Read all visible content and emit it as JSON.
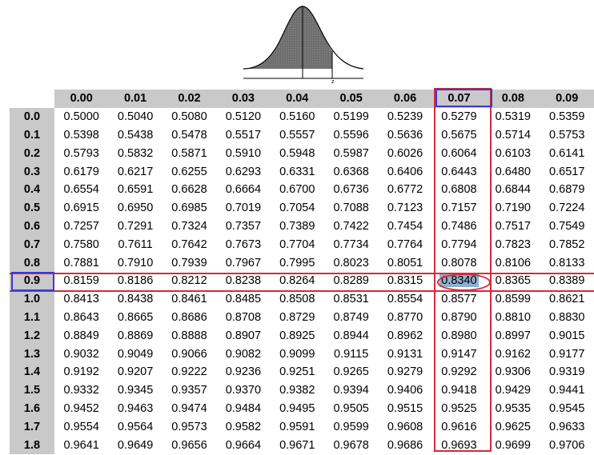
{
  "figure": {
    "z_label": "z"
  },
  "table": {
    "column_headers": [
      "0.00",
      "0.01",
      "0.02",
      "0.03",
      "0.04",
      "0.05",
      "0.06",
      "0.07",
      "0.08",
      "0.09"
    ],
    "rows": [
      {
        "z": "0.0",
        "values": [
          "0.5000",
          "0.5040",
          "0.5080",
          "0.5120",
          "0.5160",
          "0.5199",
          "0.5239",
          "0.5279",
          "0.5319",
          "0.5359"
        ]
      },
      {
        "z": "0.1",
        "values": [
          "0.5398",
          "0.5438",
          "0.5478",
          "0.5517",
          "0.5557",
          "0.5596",
          "0.5636",
          "0.5675",
          "0.5714",
          "0.5753"
        ]
      },
      {
        "z": "0.2",
        "values": [
          "0.5793",
          "0.5832",
          "0.5871",
          "0.5910",
          "0.5948",
          "0.5987",
          "0.6026",
          "0.6064",
          "0.6103",
          "0.6141"
        ]
      },
      {
        "z": "0.3",
        "values": [
          "0.6179",
          "0.6217",
          "0.6255",
          "0.6293",
          "0.6331",
          "0.6368",
          "0.6406",
          "0.6443",
          "0.6480",
          "0.6517"
        ]
      },
      {
        "z": "0.4",
        "values": [
          "0.6554",
          "0.6591",
          "0.6628",
          "0.6664",
          "0.6700",
          "0.6736",
          "0.6772",
          "0.6808",
          "0.6844",
          "0.6879"
        ]
      },
      {
        "z": "0.5",
        "values": [
          "0.6915",
          "0.6950",
          "0.6985",
          "0.7019",
          "0.7054",
          "0.7088",
          "0.7123",
          "0.7157",
          "0.7190",
          "0.7224"
        ]
      },
      {
        "z": "0.6",
        "values": [
          "0.7257",
          "0.7291",
          "0.7324",
          "0.7357",
          "0.7389",
          "0.7422",
          "0.7454",
          "0.7486",
          "0.7517",
          "0.7549"
        ]
      },
      {
        "z": "0.7",
        "values": [
          "0.7580",
          "0.7611",
          "0.7642",
          "0.7673",
          "0.7704",
          "0.7734",
          "0.7764",
          "0.7794",
          "0.7823",
          "0.7852"
        ]
      },
      {
        "z": "0.8",
        "values": [
          "0.7881",
          "0.7910",
          "0.7939",
          "0.7967",
          "0.7995",
          "0.8023",
          "0.8051",
          "0.8078",
          "0.8106",
          "0.8133"
        ]
      },
      {
        "z": "0.9",
        "values": [
          "0.8159",
          "0.8186",
          "0.8212",
          "0.8238",
          "0.8264",
          "0.8289",
          "0.8315",
          "0.8340",
          "0.8365",
          "0.8389"
        ]
      },
      {
        "z": "1.0",
        "values": [
          "0.8413",
          "0.8438",
          "0.8461",
          "0.8485",
          "0.8508",
          "0.8531",
          "0.8554",
          "0.8577",
          "0.8599",
          "0.8621"
        ]
      },
      {
        "z": "1.1",
        "values": [
          "0.8643",
          "0.8665",
          "0.8686",
          "0.8708",
          "0.8729",
          "0.8749",
          "0.8770",
          "0.8790",
          "0.8810",
          "0.8830"
        ]
      },
      {
        "z": "1.2",
        "values": [
          "0.8849",
          "0.8869",
          "0.8888",
          "0.8907",
          "0.8925",
          "0.8944",
          "0.8962",
          "0.8980",
          "0.8997",
          "0.9015"
        ]
      },
      {
        "z": "1.3",
        "values": [
          "0.9032",
          "0.9049",
          "0.9066",
          "0.9082",
          "0.9099",
          "0.9115",
          "0.9131",
          "0.9147",
          "0.9162",
          "0.9177"
        ]
      },
      {
        "z": "1.4",
        "values": [
          "0.9192",
          "0.9207",
          "0.9222",
          "0.9236",
          "0.9251",
          "0.9265",
          "0.9279",
          "0.9292",
          "0.9306",
          "0.9319"
        ]
      },
      {
        "z": "1.5",
        "values": [
          "0.9332",
          "0.9345",
          "0.9357",
          "0.9370",
          "0.9382",
          "0.9394",
          "0.9406",
          "0.9418",
          "0.9429",
          "0.9441"
        ]
      },
      {
        "z": "1.6",
        "values": [
          "0.9452",
          "0.9463",
          "0.9474",
          "0.9484",
          "0.9495",
          "0.9505",
          "0.9515",
          "0.9525",
          "0.9535",
          "0.9545"
        ]
      },
      {
        "z": "1.7",
        "values": [
          "0.9554",
          "0.9564",
          "0.9573",
          "0.9582",
          "0.9591",
          "0.9599",
          "0.9608",
          "0.9616",
          "0.9625",
          "0.9633"
        ]
      },
      {
        "z": "1.8",
        "values": [
          "0.9641",
          "0.9649",
          "0.9656",
          "0.9664",
          "0.9671",
          "0.9678",
          "0.9686",
          "0.9693",
          "0.9699",
          "0.9706"
        ]
      }
    ],
    "highlighted_row": "0.9",
    "highlighted_column": "0.07",
    "highlighted_value": "0.8340"
  },
  "colors": {
    "header_fill": "#c9c9c9",
    "column_highlight": "#d42a3a",
    "row_highlight": "#d42a3a",
    "header_box": "#3a3ad0",
    "answer_fill": "#8fb0d0"
  }
}
